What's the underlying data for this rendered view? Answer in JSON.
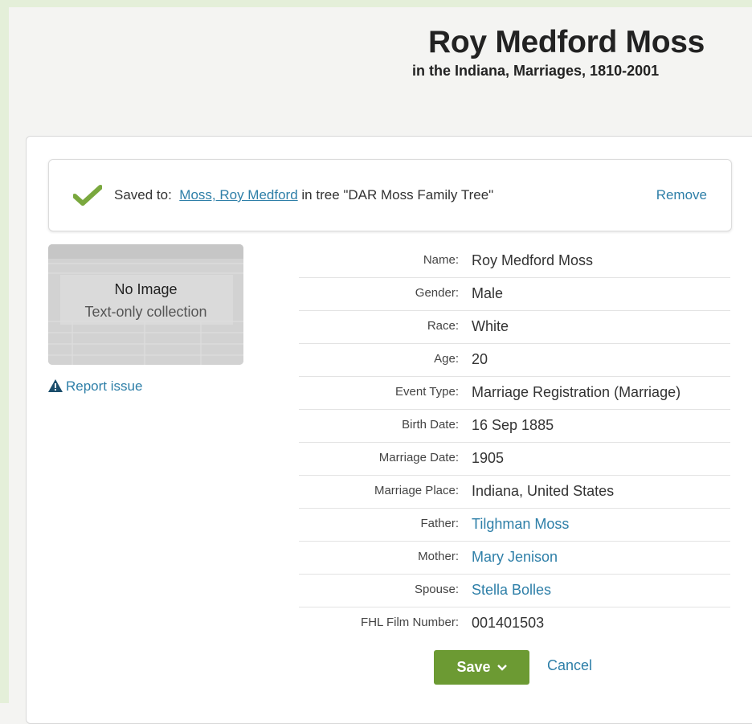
{
  "header": {
    "title": "Roy Medford Moss",
    "subtitle": "in the Indiana, Marriages, 1810-2001"
  },
  "saved": {
    "prefix": "Saved to:",
    "person_link": "Moss, Roy Medford",
    "tree_text": " in tree \"DAR Moss Family Tree\"",
    "remove_label": "Remove"
  },
  "thumbnail": {
    "line1": "No Image",
    "line2": "Text-only collection"
  },
  "report_label": "Report issue",
  "record": [
    {
      "label": "Name:",
      "value": "Roy Medford Moss",
      "link": false
    },
    {
      "label": "Gender:",
      "value": "Male",
      "link": false
    },
    {
      "label": "Race:",
      "value": "White",
      "link": false
    },
    {
      "label": "Age:",
      "value": "20",
      "link": false
    },
    {
      "label": "Event Type:",
      "value": "Marriage Registration (Marriage)",
      "link": false
    },
    {
      "label": "Birth Date:",
      "value": "16 Sep 1885",
      "link": false
    },
    {
      "label": "Marriage Date:",
      "value": "1905",
      "link": false
    },
    {
      "label": "Marriage Place:",
      "value": "Indiana, United States",
      "link": false
    },
    {
      "label": "Father:",
      "value": "Tilghman Moss",
      "link": true
    },
    {
      "label": "Mother:",
      "value": "Mary Jenison",
      "link": true
    },
    {
      "label": "Spouse:",
      "value": "Stella Bolles",
      "link": true
    },
    {
      "label": "FHL Film Number:",
      "value": "001401503",
      "link": false
    }
  ],
  "actions": {
    "save_label": "Save",
    "cancel_label": "Cancel"
  },
  "colors": {
    "accent_green": "#6c9a33",
    "link_blue": "#2e7fa8",
    "check_green": "#7aa83e"
  },
  "icons": {
    "saved": "checkmark-icon",
    "report": "warning-triangle-icon",
    "save_dropdown": "chevron-down-icon"
  }
}
